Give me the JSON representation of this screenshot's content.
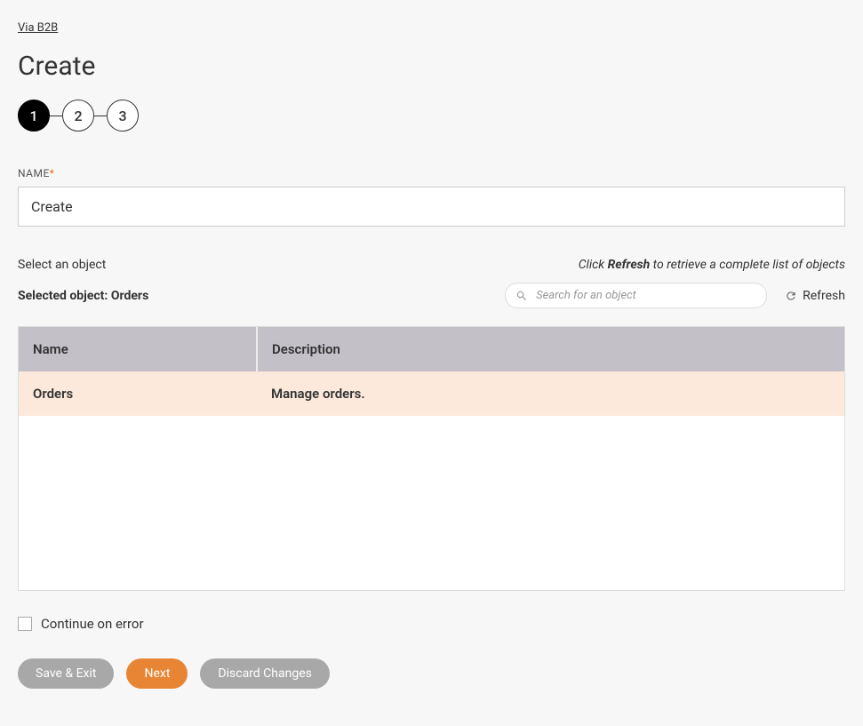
{
  "breadcrumb": "Via B2B",
  "page_title": "Create",
  "stepper": {
    "steps": [
      "1",
      "2",
      "3"
    ],
    "active_index": 0
  },
  "name_field": {
    "label": "NAME",
    "value": "Create"
  },
  "object_section": {
    "select_label": "Select an object",
    "hint_prefix": "Click ",
    "hint_bold": "Refresh",
    "hint_suffix": " to retrieve a complete list of objects",
    "selected_prefix": "Selected object: ",
    "selected_value": "Orders",
    "search_placeholder": "Search for an object",
    "refresh_label": "Refresh"
  },
  "table": {
    "headers": {
      "name": "Name",
      "description": "Description"
    },
    "rows": [
      {
        "name": "Orders",
        "description": "Manage orders.",
        "selected": true
      }
    ]
  },
  "continue_on_error": {
    "label": "Continue on error",
    "checked": false
  },
  "buttons": {
    "save_exit": "Save & Exit",
    "next": "Next",
    "discard": "Discard Changes"
  }
}
